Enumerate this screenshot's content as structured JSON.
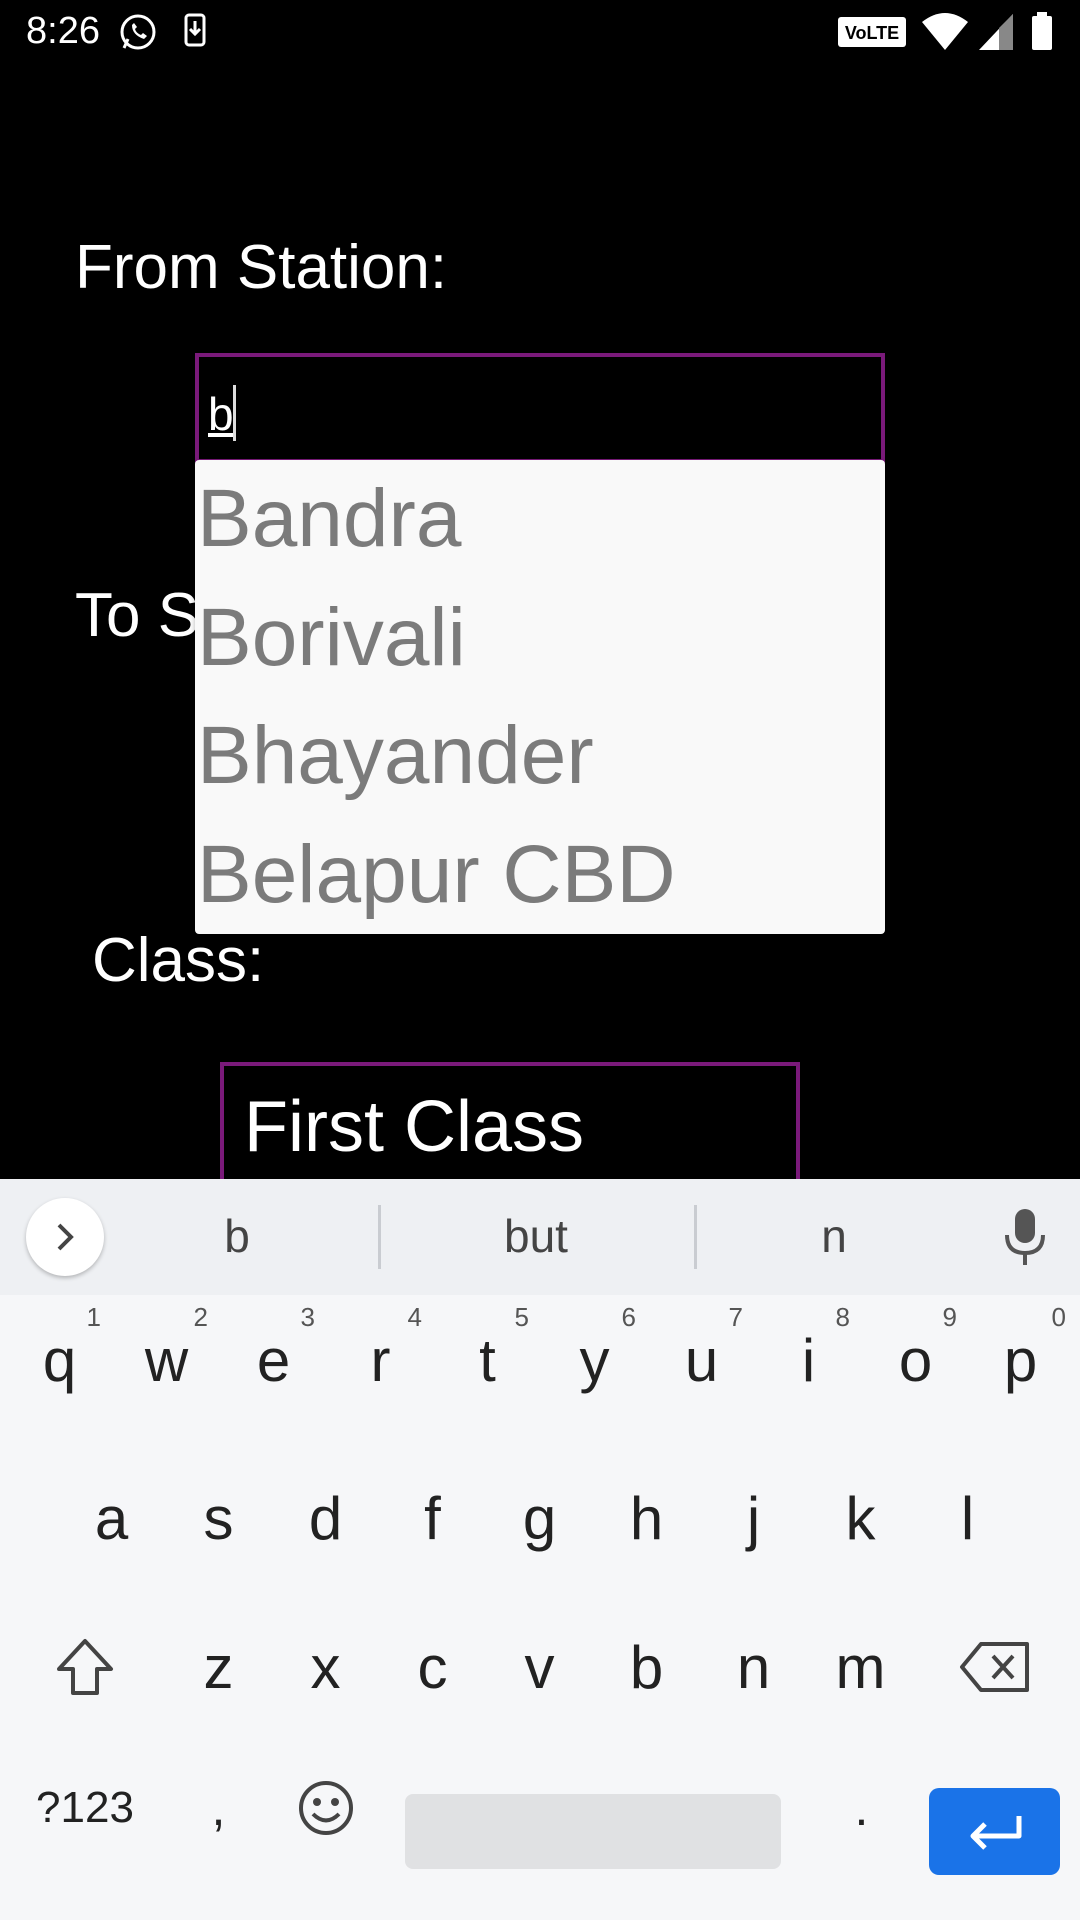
{
  "status_bar": {
    "time": "8:26",
    "network_label": "VoLTE",
    "icons": [
      "whatsapp-icon",
      "download-icon",
      "volte-icon",
      "wifi-icon",
      "signal-icon",
      "battery-icon"
    ]
  },
  "form": {
    "from_label": "From Station:",
    "from_value": "b",
    "to_label": "To S",
    "class_label": "Class:",
    "class_value": "First Class"
  },
  "dropdown": {
    "items": [
      "Bandra",
      "Borivali",
      "Bhayander",
      "Belapur CBD"
    ]
  },
  "keyboard": {
    "suggestions": [
      "b",
      "but",
      "n"
    ],
    "row1": [
      {
        "key": "q",
        "hint": "1"
      },
      {
        "key": "w",
        "hint": "2"
      },
      {
        "key": "e",
        "hint": "3"
      },
      {
        "key": "r",
        "hint": "4"
      },
      {
        "key": "t",
        "hint": "5"
      },
      {
        "key": "y",
        "hint": "6"
      },
      {
        "key": "u",
        "hint": "7"
      },
      {
        "key": "i",
        "hint": "8"
      },
      {
        "key": "o",
        "hint": "9"
      },
      {
        "key": "p",
        "hint": "0"
      }
    ],
    "row2": [
      "a",
      "s",
      "d",
      "f",
      "g",
      "h",
      "j",
      "k",
      "l"
    ],
    "row3": [
      "z",
      "x",
      "c",
      "v",
      "b",
      "n",
      "m"
    ],
    "symbols_label": "?123",
    "comma_label": ",",
    "period_label": ".",
    "colors": {
      "enter_accent": "#1a73e8",
      "field_border": "#7a1a7a",
      "dropdown_text": "#7b7b7b"
    }
  }
}
